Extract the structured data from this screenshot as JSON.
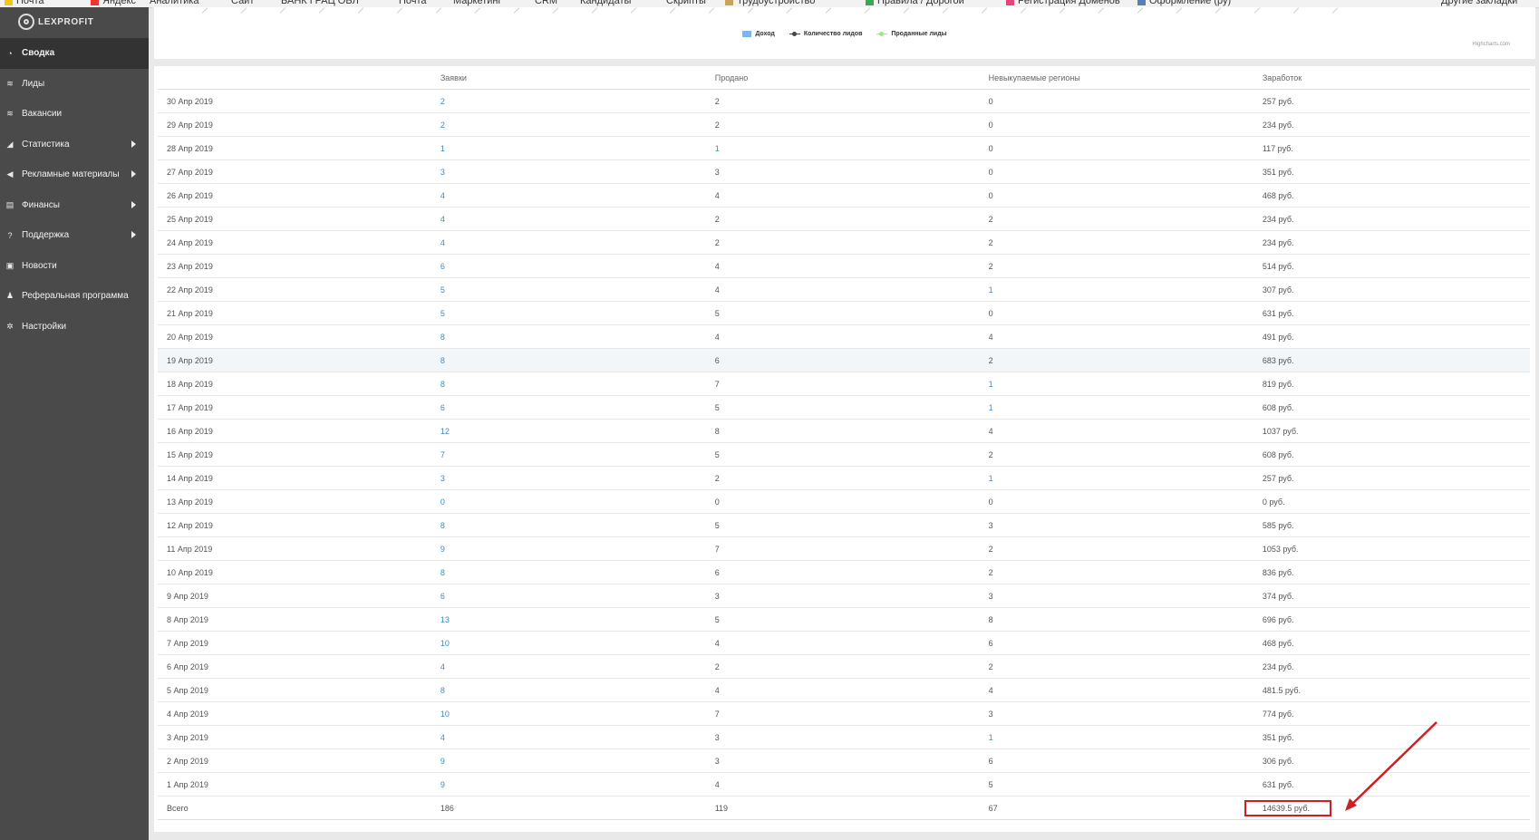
{
  "bookmarks": [
    {
      "label": "Почта",
      "color": "#f5c518"
    },
    {
      "label": "Яндекс",
      "color": "#e33"
    },
    {
      "label": "Аналитика",
      "color": ""
    },
    {
      "label": "Сайт",
      "color": ""
    },
    {
      "label": "БАНК ГРАЦ ОБЛ",
      "color": ""
    },
    {
      "label": "Почта",
      "color": ""
    },
    {
      "label": "Маркетинг",
      "color": ""
    },
    {
      "label": "CRM",
      "color": ""
    },
    {
      "label": "Кандидаты",
      "color": ""
    },
    {
      "label": "Скрипты",
      "color": ""
    },
    {
      "label": "Трудоустройство",
      "color": "#c8a45a"
    },
    {
      "label": "Правила / Дорогой",
      "color": "#3aa757"
    },
    {
      "label": "Регистрация Доменов",
      "color": "#e6457a"
    },
    {
      "label": "Оформление (ру)",
      "color": "#5b7fb5"
    },
    {
      "label": "Другие закладки",
      "color": ""
    }
  ],
  "sidebar": {
    "logo": "LEXPROFIT",
    "items": [
      {
        "label": "Сводка",
        "icon": "dashboard-icon",
        "glyph": "◔",
        "has_submenu": false,
        "active": true
      },
      {
        "label": "Лиды",
        "icon": "layers-icon",
        "glyph": "≋",
        "has_submenu": false,
        "active": false
      },
      {
        "label": "Вакансии",
        "icon": "layers-icon",
        "glyph": "≋",
        "has_submenu": false,
        "active": false
      },
      {
        "label": "Статистика",
        "icon": "chart-icon",
        "glyph": "◢",
        "has_submenu": true,
        "active": false
      },
      {
        "label": "Рекламные материалы",
        "icon": "bullhorn-icon",
        "glyph": "◀",
        "has_submenu": true,
        "active": false
      },
      {
        "label": "Финансы",
        "icon": "money-icon",
        "glyph": "▤",
        "has_submenu": true,
        "active": false
      },
      {
        "label": "Поддержка",
        "icon": "help-icon",
        "glyph": "?",
        "has_submenu": true,
        "active": false
      },
      {
        "label": "Новости",
        "icon": "newspaper-icon",
        "glyph": "▣",
        "has_submenu": false,
        "active": false
      },
      {
        "label": "Реферальная программа",
        "icon": "users-icon",
        "glyph": "♟",
        "has_submenu": false,
        "active": false
      },
      {
        "label": "Настройки",
        "icon": "gear-icon",
        "glyph": "✲",
        "has_submenu": false,
        "active": false
      }
    ]
  },
  "chart": {
    "legend": [
      {
        "label": "Доход",
        "color": "#7cb5ec",
        "kind": "rect"
      },
      {
        "label": "Количество лидов",
        "color": "#434348",
        "kind": "line"
      },
      {
        "label": "Проданные лиды",
        "color": "#90ed7d",
        "kind": "line"
      }
    ],
    "credits": "Highcharts.com"
  },
  "table": {
    "columns": [
      "",
      "Заявки",
      "Продано",
      "Невыкупаемые регионы",
      "Заработок"
    ],
    "rows": [
      [
        "30 Апр 2019",
        "2",
        "2",
        "0",
        "257 руб."
      ],
      [
        "29 Апр 2019",
        "2",
        "2",
        "0",
        "234 руб."
      ],
      [
        "28 Апр 2019",
        "1",
        "1",
        "0",
        "117 руб."
      ],
      [
        "27 Апр 2019",
        "3",
        "3",
        "0",
        "351 руб."
      ],
      [
        "26 Апр 2019",
        "4",
        "4",
        "0",
        "468 руб."
      ],
      [
        "25 Апр 2019",
        "4",
        "2",
        "2",
        "234 руб."
      ],
      [
        "24 Апр 2019",
        "4",
        "2",
        "2",
        "234 руб."
      ],
      [
        "23 Апр 2019",
        "6",
        "4",
        "2",
        "514 руб."
      ],
      [
        "22 Апр 2019",
        "5",
        "4",
        "1",
        "307 руб."
      ],
      [
        "21 Апр 2019",
        "5",
        "5",
        "0",
        "631 руб."
      ],
      [
        "20 Апр 2019",
        "8",
        "4",
        "4",
        "491 руб."
      ],
      [
        "19 Апр 2019",
        "8",
        "6",
        "2",
        "683 руб."
      ],
      [
        "18 Апр 2019",
        "8",
        "7",
        "1",
        "819 руб."
      ],
      [
        "17 Апр 2019",
        "6",
        "5",
        "1",
        "608 руб."
      ],
      [
        "16 Апр 2019",
        "12",
        "8",
        "4",
        "1037 руб."
      ],
      [
        "15 Апр 2019",
        "7",
        "5",
        "2",
        "608 руб."
      ],
      [
        "14 Апр 2019",
        "3",
        "2",
        "1",
        "257 руб."
      ],
      [
        "13 Апр 2019",
        "0",
        "0",
        "0",
        "0 руб."
      ],
      [
        "12 Апр 2019",
        "8",
        "5",
        "3",
        "585 руб."
      ],
      [
        "11 Апр 2019",
        "9",
        "7",
        "2",
        "1053 руб."
      ],
      [
        "10 Апр 2019",
        "8",
        "6",
        "2",
        "836 руб."
      ],
      [
        "9 Апр 2019",
        "6",
        "3",
        "3",
        "374 руб."
      ],
      [
        "8 Апр 2019",
        "13",
        "5",
        "8",
        "696 руб."
      ],
      [
        "7 Апр 2019",
        "10",
        "4",
        "6",
        "468 руб."
      ],
      [
        "6 Апр 2019",
        "4",
        "2",
        "2",
        "234 руб."
      ],
      [
        "5 Апр 2019",
        "8",
        "4",
        "4",
        "481.5 руб."
      ],
      [
        "4 Апр 2019",
        "10",
        "7",
        "3",
        "774 руб."
      ],
      [
        "3 Апр 2019",
        "4",
        "3",
        "1",
        "351 руб."
      ],
      [
        "2 Апр 2019",
        "9",
        "3",
        "6",
        "306 руб."
      ],
      [
        "1 Апр 2019",
        "9",
        "4",
        "5",
        "631 руб."
      ]
    ],
    "highlight_row_index": 11,
    "total": [
      "Всего",
      "186",
      "119",
      "67",
      "14639.5 руб."
    ]
  },
  "annotation": {
    "color": "#d01f24"
  }
}
